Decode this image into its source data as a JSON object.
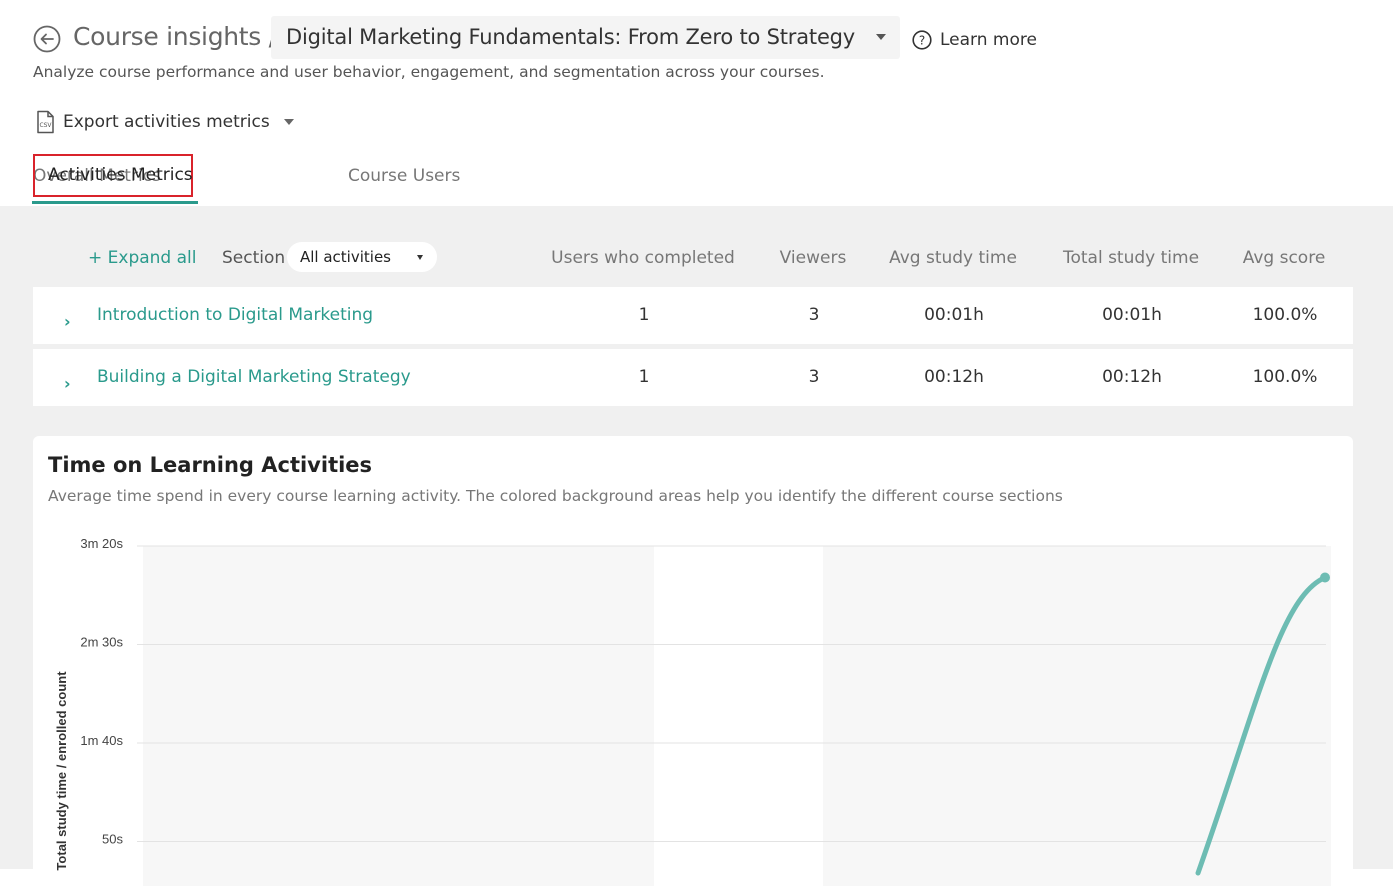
{
  "header": {
    "title": "Course insights /",
    "course_name": "Digital Marketing Fundamentals: From Zero to Strategy",
    "learn_more": "Learn more",
    "subtitle": "Analyze course performance and user behavior, engagement, and segmentation across your courses.",
    "export_label": "Export activities metrics"
  },
  "tabs": [
    {
      "label": "Overall Metrics",
      "active": false
    },
    {
      "label": "Activities Metrics",
      "active": true
    },
    {
      "label": "Course Users",
      "active": false
    }
  ],
  "filters": {
    "expand_all": "+ Expand all",
    "section_label": "Section",
    "section_value": "All activities"
  },
  "table": {
    "columns": [
      "Users who completed",
      "Viewers",
      "Avg study time",
      "Total study time",
      "Avg score"
    ],
    "rows": [
      {
        "name": "Introduction to Digital Marketing",
        "completed": "1",
        "viewers": "3",
        "avg_time": "00:01h",
        "total_time": "00:01h",
        "avg_score": "100.0%"
      },
      {
        "name": "Building a Digital Marketing Strategy",
        "completed": "1",
        "viewers": "3",
        "avg_time": "00:12h",
        "total_time": "00:12h",
        "avg_score": "100.0%"
      }
    ]
  },
  "chart_card": {
    "title": "Time on Learning Activities",
    "subtitle": "Average time spend in every course learning activity. The colored background areas help you identify the different course sections"
  },
  "chart_data": {
    "type": "line",
    "ylabel": "Total study time / enrolled count",
    "y_ticks": [
      "3m 20s",
      "2m 30s",
      "1m 40s",
      "50s"
    ],
    "y_tick_values": [
      200,
      150,
      100,
      50
    ],
    "ylim": [
      0,
      200
    ],
    "grid": true,
    "series": [
      {
        "color": "#6dbcb3",
        "points": [
          {
            "y": 34
          },
          {
            "y": 184
          }
        ]
      }
    ],
    "section_bands": [
      "#f7f7f7",
      "#ffffff",
      "#f7f7f7"
    ]
  },
  "colors": {
    "accent": "#2a9a8c",
    "highlight_border": "#d9232b",
    "line": "#6dbcb3"
  }
}
